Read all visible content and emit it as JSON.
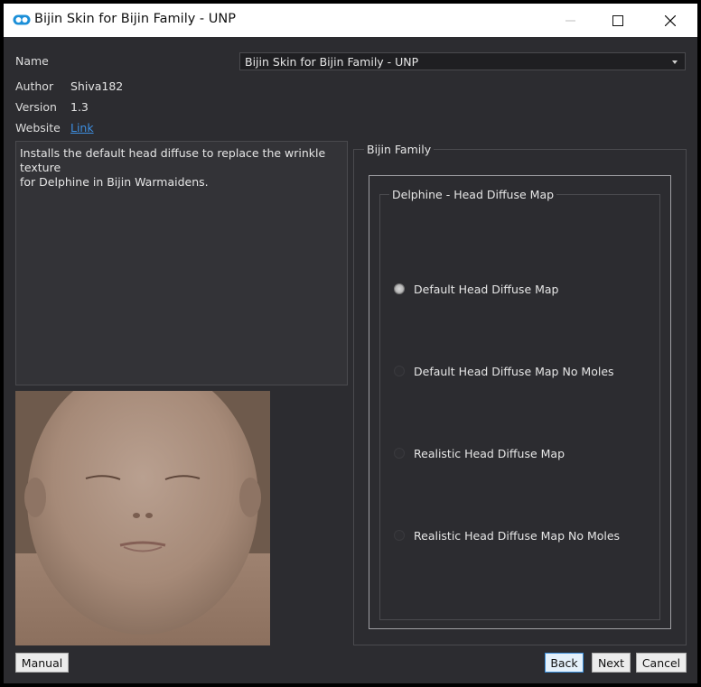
{
  "window": {
    "title": "Bijin Skin for Bijin Family - UNP",
    "logo_color": "#1b8fd8"
  },
  "info": {
    "name_label": "Name",
    "name_value": "Bijin Skin for Bijin Family - UNP",
    "author_label": "Author",
    "author_value": "Shiva182",
    "version_label": "Version",
    "version_value": "1.3",
    "website_label": "Website",
    "website_link": "Link"
  },
  "description": {
    "line1": "Installs the default head diffuse to replace the wrinkle texture",
    "line2": "for Delphine in Bijin Warmaidens."
  },
  "group": {
    "title": "Bijin Family",
    "inner_title": "Delphine - Head Diffuse Map",
    "options": [
      {
        "label": "Default Head Diffuse Map",
        "checked": true
      },
      {
        "label": "Default Head Diffuse Map No Moles",
        "checked": false
      },
      {
        "label": "Realistic Head Diffuse Map",
        "checked": false
      },
      {
        "label": "Realistic Head Diffuse Map No Moles",
        "checked": false
      }
    ]
  },
  "buttons": {
    "manual": "Manual",
    "back": "Back",
    "next": "Next",
    "cancel": "Cancel"
  }
}
